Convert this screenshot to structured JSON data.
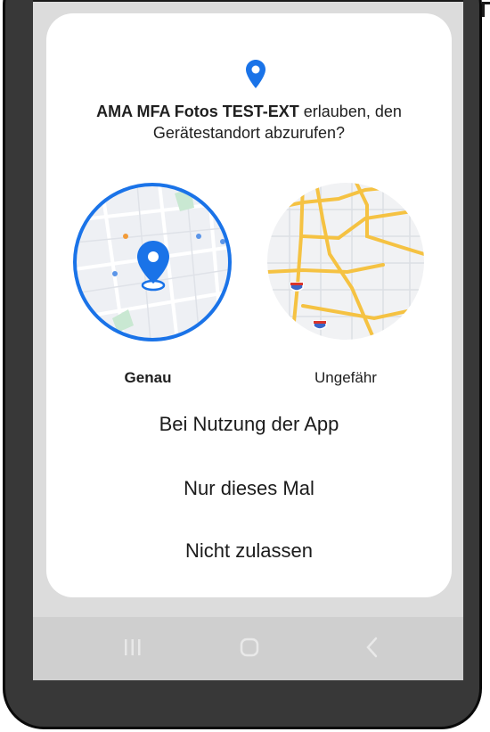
{
  "dialog": {
    "title_app": "AMA MFA Fotos TEST-EXT",
    "title_rest": " erlauben, den Gerätestandort abzurufen?",
    "options": {
      "precise": {
        "label": "Genau",
        "selected": true
      },
      "approximate": {
        "label": "Ungefähr",
        "selected": false
      }
    },
    "buttons": {
      "while_using": "Bei Nutzung der App",
      "only_this_time": "Nur dieses Mal",
      "deny": "Nicht zulassen"
    }
  },
  "navbar": {
    "icons": [
      "recents-icon",
      "home-icon",
      "back-icon"
    ]
  },
  "colors": {
    "accent": "#1a73e8",
    "dialog_bg": "#ffffff",
    "screen_bg": "#dcdcdc",
    "phone_frame": "#383838",
    "road_yellow": "#f5c242"
  }
}
